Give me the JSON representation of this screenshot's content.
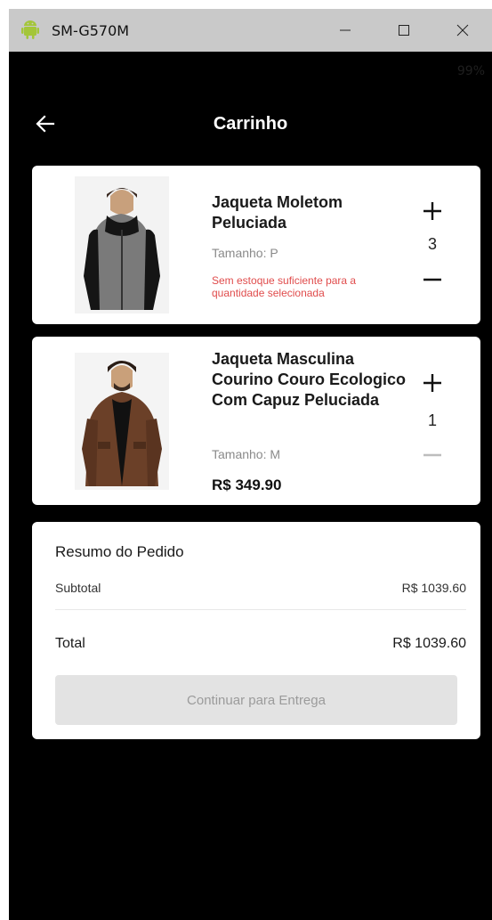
{
  "window": {
    "title": "SM-G570M",
    "minimize_label": "—",
    "maximize_label": "☐",
    "close_label": "✕"
  },
  "statusbar": {
    "left": "",
    "right": "99%"
  },
  "appbar": {
    "title": "Carrinho"
  },
  "cart": {
    "items": [
      {
        "name": "Jaqueta Moletom Peluciada",
        "size": "Tamanho: P",
        "warning": "Sem estoque suficiente para a quantidade selecionada",
        "price": "",
        "quantity": "3"
      },
      {
        "name": "Jaqueta Masculina Courino Couro Ecologico Com Capuz Peluciada",
        "size": "Tamanho: M",
        "warning": "",
        "price": "R$ 349.90",
        "quantity": "1"
      }
    ]
  },
  "summary": {
    "title": "Resumo do Pedido",
    "subtotal_label": "Subtotal",
    "subtotal_value": "R$ 1039.60",
    "total_label": "Total",
    "total_value": "R$ 1039.60",
    "continue_label": "Continuar para Entrega"
  },
  "colors": {
    "background": "#000000",
    "card": "#ffffff",
    "warning": "#e04c4c",
    "button_disabled": "#e3e3e3",
    "android_green": "#a4c639"
  }
}
